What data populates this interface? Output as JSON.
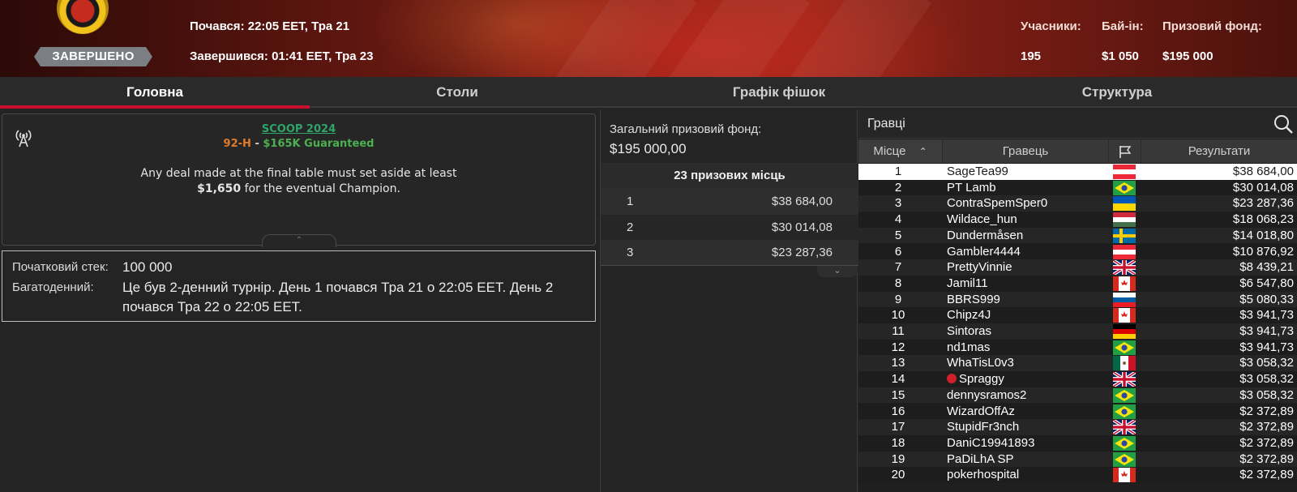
{
  "header": {
    "status": "ЗАВЕРШЕНО",
    "started": "Почався: 22:05 EET, Тра 21",
    "ended": "Завершився: 01:41 EET, Тра 23",
    "entrants_label": "Учасники:",
    "entrants_value": "195",
    "buyin_label": "Бай-ін:",
    "buyin_value": "$1 050",
    "prizepool_label": "Призовий фонд:",
    "prizepool_value": "$195 000"
  },
  "tabs": [
    {
      "label": "Головна",
      "active": true
    },
    {
      "label": "Столи",
      "active": false
    },
    {
      "label": "Графік фішок",
      "active": false
    },
    {
      "label": "Структура",
      "active": false
    }
  ],
  "info": {
    "series": "SCOOP 2024",
    "event_code": "92-H",
    "event_sep": " - ",
    "event_name": "$165K Guaranteed",
    "deal_line1": "Any deal made at the final table must set aside at least",
    "deal_amount": "$1,650",
    "deal_line2_rest": " for the eventual Champion."
  },
  "details": {
    "stack_label": "Початковий стек:",
    "stack_value": "100 000",
    "multiday_label": "Багатоденний:",
    "multiday_value": "Це був 2-денний турнір. День 1 почався Тра 21 о 22:05 EET. День 2 почався Тра 22 о 22:05 EET."
  },
  "prizes": {
    "pool_label": "Загальний призовий фонд:",
    "pool_value": "$195 000,00",
    "paid_places": "23 призових місць",
    "rows": [
      {
        "place": "1",
        "amount": "$38 684,00"
      },
      {
        "place": "2",
        "amount": "$30 014,08"
      },
      {
        "place": "3",
        "amount": "$23 287,36"
      }
    ]
  },
  "players": {
    "title": "Гравці",
    "col_place": "Місце",
    "col_player": "Гравець",
    "col_result": "Результати",
    "rows": [
      {
        "place": "1",
        "name": "SageTea99",
        "flag": "AT",
        "result": "$38 684,00"
      },
      {
        "place": "2",
        "name": "PT Lamb",
        "flag": "BR",
        "result": "$30 014,08"
      },
      {
        "place": "3",
        "name": "ContraSpemSper0",
        "flag": "UA",
        "result": "$23 287,36"
      },
      {
        "place": "4",
        "name": "Wildace_hun",
        "flag": "HU",
        "result": "$18 068,23"
      },
      {
        "place": "5",
        "name": "Dundermåsen",
        "flag": "SE",
        "result": "$14 018,80"
      },
      {
        "place": "6",
        "name": "Gambler4444",
        "flag": "AT",
        "result": "$10 876,92"
      },
      {
        "place": "7",
        "name": "PrettyVinnie",
        "flag": "GB",
        "result": "$8 439,21"
      },
      {
        "place": "8",
        "name": "Jamil11",
        "flag": "CA",
        "result": "$6 547,80"
      },
      {
        "place": "9",
        "name": "BBRS999",
        "flag": "SI",
        "result": "$5 080,33"
      },
      {
        "place": "10",
        "name": "Chipz4J",
        "flag": "CA",
        "result": "$3 941,73"
      },
      {
        "place": "11",
        "name": "Sintoras",
        "flag": "DE",
        "result": "$3 941,73"
      },
      {
        "place": "12",
        "name": "nd1mas",
        "flag": "BR",
        "result": "$3 941,73"
      },
      {
        "place": "13",
        "name": "WhaTisL0v3",
        "flag": "MX",
        "result": "$3 058,32"
      },
      {
        "place": "14",
        "name": "Spraggy",
        "flag": "GB",
        "result": "$3 058,32",
        "star": true
      },
      {
        "place": "15",
        "name": "dennysramos2",
        "flag": "BR",
        "result": "$3 058,32"
      },
      {
        "place": "16",
        "name": "WizardOffAz",
        "flag": "BR",
        "result": "$2 372,89"
      },
      {
        "place": "17",
        "name": "StupidFr3nch",
        "flag": "GB",
        "result": "$2 372,89"
      },
      {
        "place": "18",
        "name": "DaniC19941893",
        "flag": "BR",
        "result": "$2 372,89"
      },
      {
        "place": "19",
        "name": "PaDiLhA SP",
        "flag": "BR",
        "result": "$2 372,89"
      },
      {
        "place": "20",
        "name": "pokerhospital",
        "flag": "CA",
        "result": "$2 372,89"
      }
    ]
  },
  "colors": {
    "accent_red": "#c8102e",
    "link_green": "#2fa56a",
    "event_orange": "#e07b2a",
    "guaranteed_green": "#4caf50"
  }
}
